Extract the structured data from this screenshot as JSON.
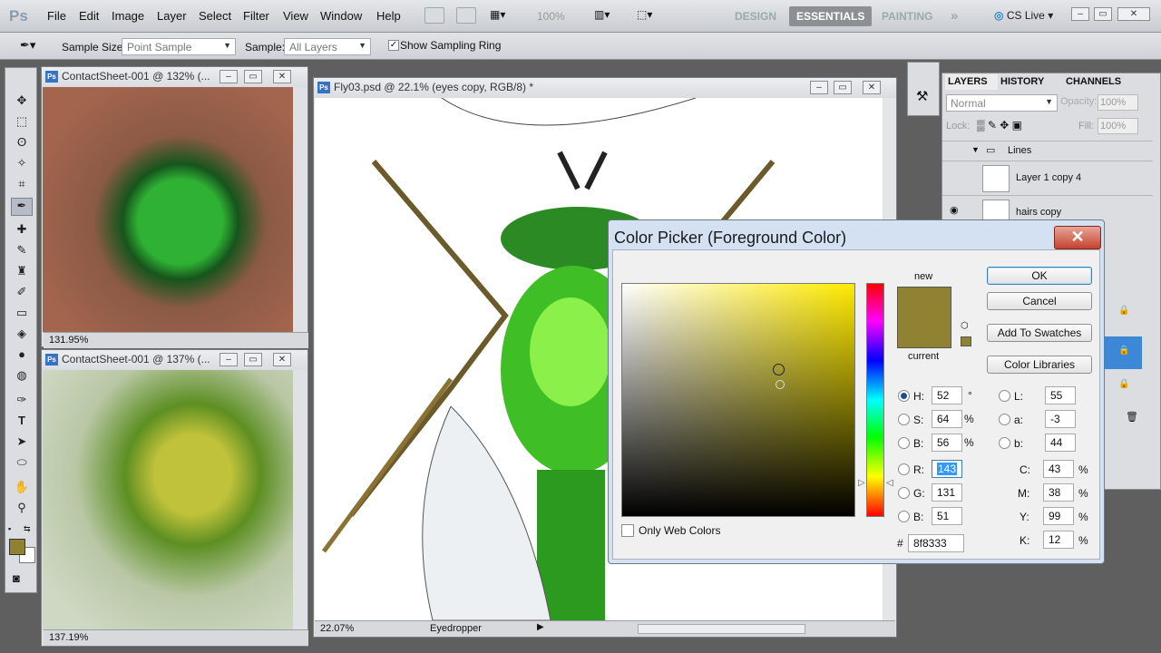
{
  "app": {
    "logo": "Ps"
  },
  "menu": [
    "File",
    "Edit",
    "Image",
    "Layer",
    "Select",
    "Filter",
    "View",
    "Window",
    "Help"
  ],
  "zoom_display": "100%",
  "workspaces": {
    "design": "DESIGN",
    "essentials": "ESSENTIALS",
    "painting": "PAINTING",
    "more": "»",
    "cslive": "CS Live"
  },
  "options": {
    "sample_size_label": "Sample Size:",
    "sample_size_value": "Point Sample",
    "sample_label": "Sample:",
    "sample_value": "All Layers",
    "show_ring_label": "Show Sampling Ring"
  },
  "doc1": {
    "title": "ContactSheet-001 @ 132% (...",
    "zoom": "131.95%"
  },
  "doc2": {
    "title": "ContactSheet-001 @ 137% (...",
    "zoom": "137.19%"
  },
  "main_doc": {
    "title": "Fly03.psd @ 22.1% (eyes copy, RGB/8) *",
    "zoom": "22.07%",
    "status_tool": "Eyedropper"
  },
  "layers_panel": {
    "tabs": [
      "LAYERS",
      "HISTORY",
      "CHANNELS"
    ],
    "blend_mode": "Normal",
    "opacity_label": "Opacity:",
    "opacity": "100%",
    "lock_label": "Lock:",
    "fill_label": "Fill:",
    "fill": "100%",
    "group": "Lines",
    "layers": [
      "Layer 1 copy 4",
      "hairs copy"
    ]
  },
  "color_picker": {
    "title": "Color Picker (Foreground Color)",
    "close": "✕",
    "ok": "OK",
    "cancel": "Cancel",
    "add_swatches": "Add To Swatches",
    "color_libraries": "Color Libraries",
    "new_label": "new",
    "current_label": "current",
    "new_color": "#8f8333",
    "current_color": "#8f8333",
    "only_web": "Only Web Colors",
    "hsb": {
      "H": "52",
      "S": "64",
      "B": "56",
      "h_unit": "°",
      "s_unit": "%",
      "b_unit": "%"
    },
    "rgb": {
      "R": "143",
      "G": "131",
      "B": "51"
    },
    "lab": {
      "L": "55",
      "a": "-3",
      "b": "44"
    },
    "cmyk": {
      "C": "43",
      "M": "38",
      "Y": "99",
      "K": "12"
    },
    "pct": "%",
    "hex_label": "#",
    "hex": "8f8333",
    "labels": {
      "H": "H:",
      "S": "S:",
      "B": "B:",
      "R": "R:",
      "G": "G:",
      "B2": "B:",
      "L": "L:",
      "a": "a:",
      "b": "b:",
      "C": "C:",
      "M": "M:",
      "Y": "Y:",
      "K": "K:"
    }
  },
  "colors": {
    "foreground": "#8f8333",
    "background": "#ffffff",
    "hue_base": "#ffea00"
  }
}
